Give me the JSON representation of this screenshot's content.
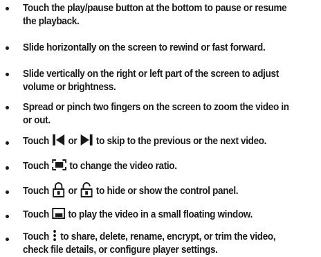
{
  "bullets": [
    {
      "lines": [
        "Touch the play/pause button at the bottom to pause or resume",
        "the playback."
      ]
    },
    {
      "lines": [
        "Slide horizontally on the screen to rewind or fast forward."
      ]
    },
    {
      "lines": [
        "Slide vertically on the right or left part of the screen to adjust",
        "volume or brightness."
      ]
    },
    {
      "lines": [
        "Spread or pinch two fingers on the screen to zoom the video in",
        "or out."
      ]
    },
    {
      "parts": [
        "Touch",
        "or",
        "to skip to the previous or the next video."
      ],
      "icons": [
        "skip-previous-icon",
        "skip-next-icon"
      ]
    },
    {
      "parts": [
        "Touch",
        "to change the video ratio."
      ],
      "icons": [
        "aspect-ratio-icon"
      ]
    },
    {
      "parts": [
        "Touch",
        "or",
        "to hide or show the control panel."
      ],
      "icons": [
        "lock-icon",
        "unlock-icon"
      ]
    },
    {
      "parts": [
        "Touch",
        "to play the video in a small floating window."
      ],
      "icons": [
        "floating-window-icon"
      ]
    },
    {
      "parts": [
        "Touch",
        "to share, delete, rename, encrypt, or trim the video,"
      ],
      "line2": "check file details, or configure player settings.",
      "icons": [
        "more-options-icon"
      ]
    }
  ]
}
